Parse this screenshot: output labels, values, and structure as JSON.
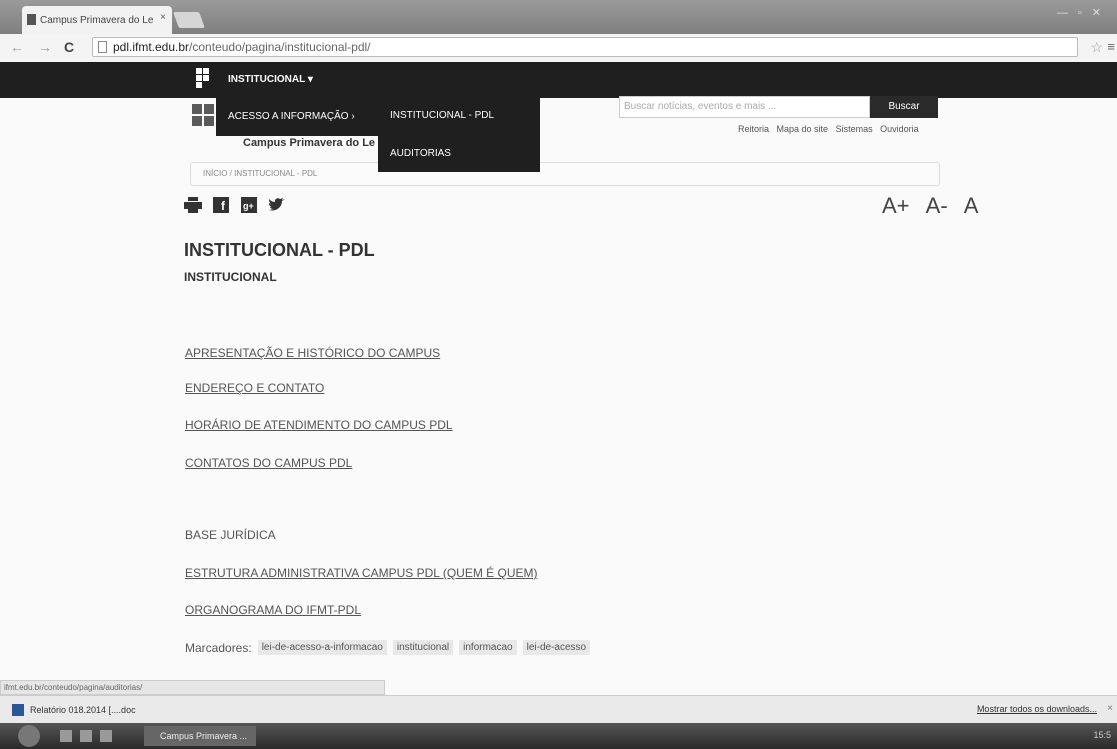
{
  "browser": {
    "tab_title": "Campus Primavera do Le",
    "tab_close": "×",
    "url_host": "pdl.ifmt.edu.br",
    "url_path": "/conteudo/pagina/institucional-pdl/",
    "nav": {
      "back": "←",
      "forward": "→",
      "reload": "C"
    }
  },
  "site": {
    "top_menu": "INSTITUCIONAL ▾",
    "submenu_item": "ACESSO A INFORMAÇÃO  ›",
    "submenu2": [
      "INSTITUCIONAL - PDL",
      "AUDITORIAS"
    ],
    "campus_name": "Campus Primavera do Le",
    "search_placeholder": "Buscar notícias, eventos e mais ...",
    "search_button": "Buscar",
    "quick_links": [
      "Reitoria",
      "Mapa do site",
      "Sistemas",
      "Ouvidoria"
    ],
    "breadcrumb": "INÍCIO  /  INSTITUCIONAL - PDL"
  },
  "tools": {
    "font_controls": [
      "A+",
      "A-",
      "A"
    ]
  },
  "content": {
    "title": "INSTITUCIONAL - PDL",
    "subtitle": "INSTITUCIONAL",
    "links1": [
      "APRESENTAÇÃO E HISTÓRICO DO CAMPUS",
      "ENDEREÇO E CONTATO",
      "HORÁRIO DE ATENDIMENTO DO CAMPUS PDL",
      "CONTATOS DO CAMPUS PDL"
    ],
    "base_juridica": "BASE JURÍDICA",
    "links2": [
      "ESTRUTURA ADMINISTRATIVA CAMPUS PDL (QUEM É QUEM)",
      "ORGANOGRAMA DO IFMT-PDL"
    ],
    "tags_label": "Marcadores:",
    "tags": [
      "lei-de-acesso-a-informacao",
      "institucional",
      "informacao",
      "lei-de-acesso"
    ]
  },
  "status": {
    "url": "ifmt.edu.br/conteudo/pagina/auditorias/"
  },
  "downloads": {
    "item": "Relatório 018.2014 [....doc",
    "show_all": "Mostrar todos os downloads...",
    "close": "×"
  },
  "taskbar": {
    "task": "Campus Primavera ...",
    "clock": "15:5"
  }
}
